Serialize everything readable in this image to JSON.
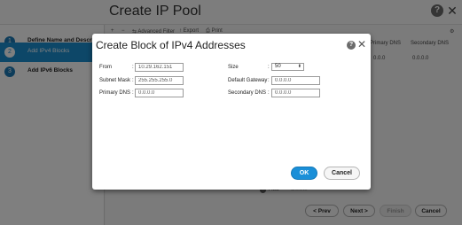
{
  "wizard": {
    "title": "Create IP Pool",
    "help_label": "?",
    "close_label": "✕",
    "steps": [
      {
        "num": "1",
        "label": "Define Name and Description"
      },
      {
        "num": "2",
        "label": "Add IPv4 Blocks"
      },
      {
        "num": "3",
        "label": "Add IPv6 Blocks"
      }
    ],
    "toolbar": {
      "add": "+",
      "remove": "−",
      "advanced_filter": "⇆ Advanced Filter",
      "export": "↑ Export",
      "print": "⎙ Print",
      "settings": "⚙"
    },
    "columns": [
      "Primary DNS",
      "Secondary DNS"
    ],
    "row_values": [
      "0.0.0",
      "0.0.0.0"
    ],
    "add_label": "Add",
    "delete_label": "Delete",
    "buttons": {
      "prev": "< Prev",
      "next": "Next >",
      "finish": "Finish",
      "cancel": "Cancel"
    }
  },
  "dialog": {
    "title": "Create Block of IPv4 Addresses",
    "help_label": "?",
    "close_label": "✕",
    "fields": {
      "from": {
        "label": "From",
        "value": "10.29.162.151"
      },
      "size": {
        "label": "Size",
        "value": "50"
      },
      "subnet_mask": {
        "label": "Subnet Mask",
        "value": "255.255.255.0"
      },
      "default_gateway": {
        "label": "Default Gateway",
        "value": "0.0.0.0"
      },
      "primary_dns": {
        "label": "Primary DNS",
        "value": "0.0.0.0"
      },
      "secondary_dns": {
        "label": "Secondary DNS",
        "value": "0.0.0.0"
      }
    },
    "colon": ":",
    "ok_label": "OK",
    "cancel_label": "Cancel"
  },
  "colors": {
    "accent": "#1b8ed1",
    "ok_button": "#1a8fd8",
    "overlay": "rgba(0,0,0,0.5)"
  }
}
